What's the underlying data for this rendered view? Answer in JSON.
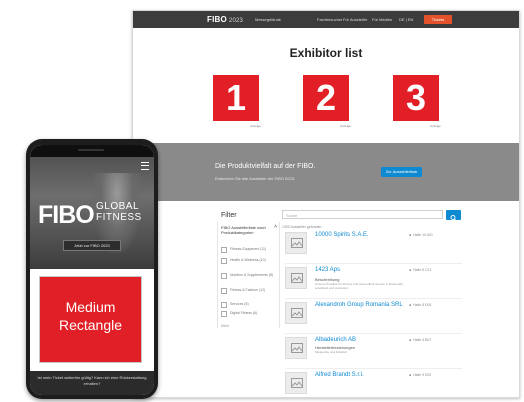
{
  "desktop": {
    "nav": {
      "logo": "FIBO",
      "logo_tag": "2023",
      "location": "Messegelände",
      "links": [
        "Fachbesucher",
        "Für Aussteller",
        "Für Medien",
        "DE | EN"
      ],
      "cta": "Tickets"
    },
    "title": "Exhibitor list",
    "slots": [
      {
        "number": "1",
        "caption": "Anzeige"
      },
      {
        "number": "2",
        "caption": "Anzeige"
      },
      {
        "number": "3",
        "caption": "Anzeige"
      }
    ],
    "banner": {
      "title": "Die Produktvielfalt auf der FIBO.",
      "subtitle": "Entdecken Sie alle Aussteller der FIBO 2023.",
      "button": "Zur Ausstellerliste"
    },
    "filter": {
      "title": "Filter",
      "category": "FIBO Ausstellerliste nach Produktkategorien",
      "items": [
        "Fitness-Equipment (11)",
        "Health & Wellness (10)",
        "Nutrition & Supplements (8)",
        "Fitness & Fashion (12)",
        "Services (5)",
        "Digital Fitness (6)"
      ],
      "more": "Mehr"
    },
    "search": {
      "placeholder": "Suche",
      "results": "1300 Aussteller gefunden"
    },
    "exhibitors": [
      {
        "name": "10000 Spirits S.A.E.",
        "location": "Halle 10 A01",
        "sub": "",
        "desc": ""
      },
      {
        "name": "1423 Aps",
        "location": "Halle 6 C12",
        "sub": "Beschreibung",
        "desc": "Unsere Produkte für Fitness und Gesundheit werden in Dänemark entwickelt und produziert."
      },
      {
        "name": "Alexandroh Group Romania SRL",
        "location": "Halle 8 D04",
        "sub": "",
        "desc": ""
      },
      {
        "name": "Albadeurich AB",
        "location": "Halle 4 B07",
        "sub": "Herstellerbeziehungen",
        "desc": "Mietgeräte und Zubehör"
      },
      {
        "name": "Alfred Brandt S.r.l.",
        "location": "Halle 9 E02",
        "sub": "",
        "desc": ""
      }
    ]
  },
  "phone": {
    "logo": "FIBO",
    "logo_sub1": "GLOBAL",
    "logo_sub2": "FITNESS",
    "cta": "Jetzt zur FIBO 2023",
    "ad_line1": "Medium",
    "ad_line2": "Rectangle",
    "footer": "Ist mein Ticket weiterhin gültig? Kann ich eine Rückerstattung erhalten?"
  },
  "colors": {
    "accent_red": "#e21f26",
    "accent_blue": "#0d8ad2",
    "nav_dark": "#3c3c3c"
  }
}
